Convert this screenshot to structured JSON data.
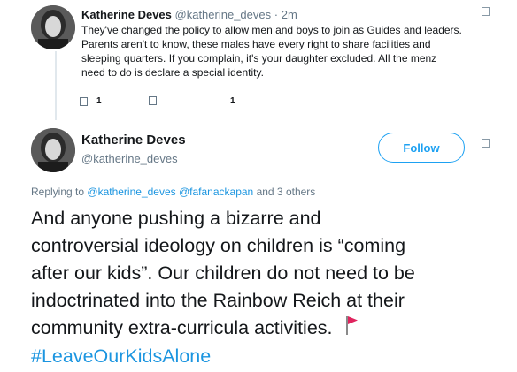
{
  "tweet1": {
    "author_name": "Katherine Deves",
    "author_handle": "@katherine_deves",
    "separator": "·",
    "time": "2m",
    "text_lines": [
      "They've changed the policy to allow men and boys to join as Guides and leaders.",
      "Parents aren't to know, these males have every right to share facilities and",
      "sleeping quarters. If you complain, it's your daughter excluded. All the menz",
      "need to do is declare a special identity."
    ],
    "reply_count": "1",
    "like_count": "1"
  },
  "tweet2": {
    "author_name": "Katherine Deves",
    "author_handle": "@katherine_deves",
    "follow_label": "Follow",
    "replying_prefix": "Replying to",
    "mention_1": "@katherine_deves",
    "mention_2": "@fafanackapan",
    "replying_suffix": "and 3 others",
    "text_lines": [
      "And anyone pushing a bizarre and",
      "controversial ideology on children is “coming",
      "after our kids”. Our children do not need to be",
      "indoctrinated into the Rainbow Reich at their",
      "community extra-curricula activities."
    ],
    "hashtag": "#LeaveOurKidsAlone",
    "flag_emoji": "red-flag-icon"
  },
  "colors": {
    "link": "#1b95e0",
    "muted": "#657786",
    "text": "#14171a",
    "follow_border": "#1da1f2",
    "flag": "#e0245e"
  }
}
